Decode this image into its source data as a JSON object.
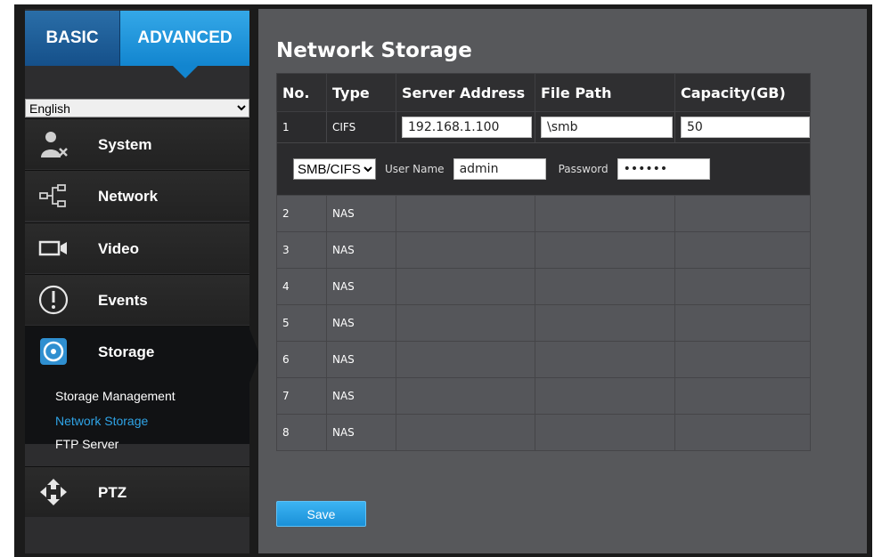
{
  "tabs": {
    "basic": "BASIC",
    "advanced": "ADVANCED"
  },
  "language": {
    "selected": "English"
  },
  "menu": {
    "system": "System",
    "network": "Network",
    "video": "Video",
    "events": "Events",
    "storage": "Storage",
    "storage_sub": [
      "Storage Management",
      "Network Storage",
      "FTP Server"
    ],
    "ptz": "PTZ"
  },
  "page_title": "Network Storage",
  "table": {
    "headers": [
      "No.",
      "Type",
      "Server Address",
      "File Path",
      "Capacity(GB)"
    ],
    "first_row": {
      "no": "1",
      "type": "CIFS",
      "server_address": "192.168.1.100",
      "file_path": "\\smb",
      "capacity": "50",
      "protocol": "SMB/CIFS",
      "user_label": "User Name",
      "user_value": "admin",
      "password_label": "Password",
      "password_value": "••••••"
    },
    "rows": [
      {
        "no": "2",
        "type": "NAS"
      },
      {
        "no": "3",
        "type": "NAS"
      },
      {
        "no": "4",
        "type": "NAS"
      },
      {
        "no": "5",
        "type": "NAS"
      },
      {
        "no": "6",
        "type": "NAS"
      },
      {
        "no": "7",
        "type": "NAS"
      },
      {
        "no": "8",
        "type": "NAS"
      }
    ]
  },
  "save_label": "Save",
  "colors": {
    "accent": "#1285cf",
    "active_link": "#2fa4e7",
    "panel": "#57585b",
    "sidebar": "#2d2d2f"
  }
}
